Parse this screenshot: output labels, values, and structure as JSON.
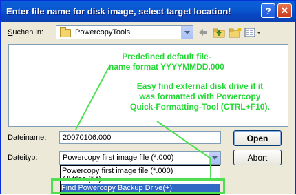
{
  "dialog": {
    "title": "Enter file name for disk image, select target location!",
    "help_button": "?",
    "close_button": "✕"
  },
  "location": {
    "label_prefix": "S",
    "label_rest": "uchen in:",
    "value": "PowercopyTools"
  },
  "toolbar": {
    "back_icon": "back-arrow-icon",
    "up_icon": "up-folder-icon",
    "new_folder_icon": "new-folder-icon",
    "view_icon": "view-menu-icon"
  },
  "filename": {
    "label_prefix": "Datei",
    "label_underlined": "n",
    "label_rest": "ame:",
    "value": "20070106.000"
  },
  "filetype": {
    "label_prefix": "Datei",
    "label_underlined": "t",
    "label_rest": "yp:",
    "value": "Powercopy first image file (*.000)",
    "options": [
      "Powercopy first image file (*.000)",
      "All files (*.*)",
      "Find Powercopy Backup Drive(+)"
    ]
  },
  "buttons": {
    "open": "Open",
    "abort": "Abort"
  },
  "annotations": {
    "default_format": "Predefined default file-\nname format YYYYMMDD.000",
    "find_drive": "Easy find external disk drive if it\nwas formatted with Powercopy\nQuick-Formatting-Tool (CTRL+F10)."
  },
  "colors": {
    "annotation_green": "#25d836",
    "title_bar": "#0a58d0",
    "selection": "#316ac5"
  }
}
